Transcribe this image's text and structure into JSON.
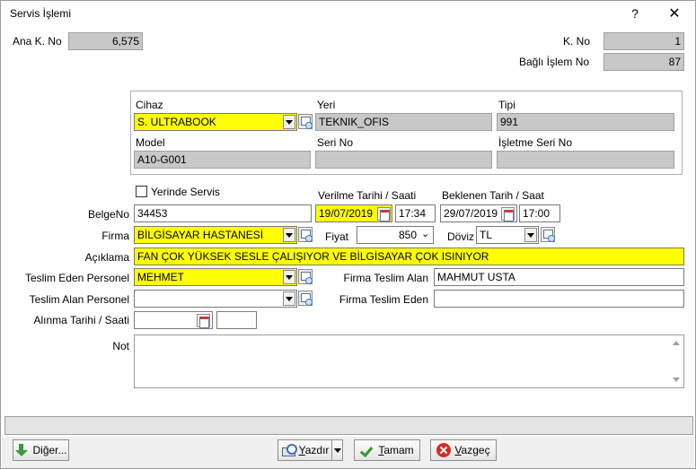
{
  "window": {
    "title": "Servis İşlemi",
    "help": "?",
    "close": "✕"
  },
  "header": {
    "ana_k_no_label": "Ana K. No",
    "ana_k_no": "6,575",
    "k_no_label": "K. No",
    "k_no": "1",
    "bagli_islem_no_label": "Bağlı İşlem No",
    "bagli_islem_no": "87"
  },
  "device": {
    "cihaz_label": "Cihaz",
    "cihaz": "S. ULTRABOOK",
    "yeri_label": "Yeri",
    "yeri": "TEKNIK_OFIS",
    "tipi_label": "Tipi",
    "tipi": "991",
    "model_label": "Model",
    "model": "A10-G001",
    "seri_no_label": "Seri No",
    "seri_no": "",
    "isletme_seri_no_label": "İşletme Seri No",
    "isletme_seri_no": ""
  },
  "form": {
    "yerinde_servis_label": "Yerinde Servis",
    "verilme_label": "Verilme Tarihi / Saati",
    "beklenen_label": "Beklenen Tarih / Saat",
    "belge_no_label": "BelgeNo",
    "belge_no": "34453",
    "verilme_tarih": "19/07/2019",
    "verilme_saat": "17:34",
    "beklenen_tarih": "29/07/2019",
    "beklenen_saat": "17:00",
    "firma_label": "Firma",
    "firma": "BİLGİSAYAR HASTANESİ",
    "fiyat_label": "Fiyat",
    "fiyat": "850",
    "doviz_label": "Döviz",
    "doviz": "TL",
    "aciklama_label": "Açıklama",
    "aciklama": "FAN ÇOK YÜKSEK SESLE ÇALIŞIYOR VE BİLGİSAYAR ÇOK ISINIYOR",
    "teslim_eden_label": "Teslim Eden Personel",
    "teslim_eden": "MEHMET",
    "firma_teslim_alan_label": "Firma Teslim Alan",
    "firma_teslim_alan": "MAHMUT USTA",
    "teslim_alan_label": "Teslim Alan Personel",
    "teslim_alan": "",
    "firma_teslim_eden_label": "Firma Teslim Eden",
    "firma_teslim_eden": "",
    "alinma_label": "Alınma Tarihi / Saati",
    "alinma_tarih": "",
    "alinma_saat": "",
    "not_label": "Not",
    "not": ""
  },
  "footer": {
    "diger_pre": "Di",
    "diger_u": "ğ",
    "diger_post": "er...",
    "yazdir_u": "Y",
    "yazdir_post": "azdır",
    "tamam_u": "T",
    "tamam_post": "amam",
    "vazgec_u": "V",
    "vazgec_post": "azgeç"
  },
  "colors": {
    "highlight": "#ffff00",
    "readonly": "#c8c8c8"
  }
}
